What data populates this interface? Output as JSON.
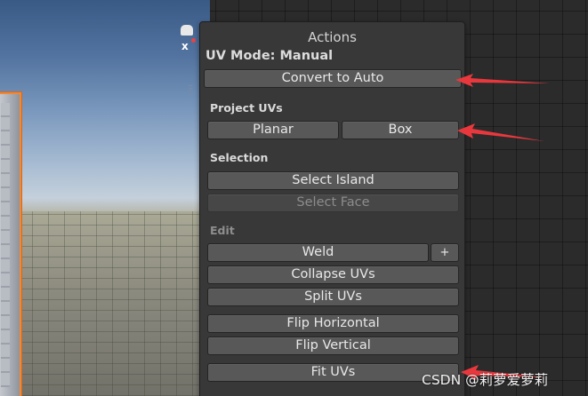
{
  "scene": {
    "gizmo_axis_label": "x"
  },
  "panel": {
    "title": "Actions",
    "mode_label": "UV Mode: Manual",
    "convert_button": "Convert to Auto",
    "sections": {
      "project_uvs": "Project UVs",
      "selection": "Selection",
      "edit": "Edit"
    },
    "buttons": {
      "planar": "Planar",
      "box": "Box",
      "select_island": "Select Island",
      "select_face": "Select Face",
      "weld": "Weld",
      "weld_plus": "+",
      "collapse_uvs": "Collapse UVs",
      "split_uvs": "Split UVs",
      "flip_horizontal": "Flip Horizontal",
      "flip_vertical": "Flip Vertical",
      "fit_uvs": "Fit UVs"
    }
  },
  "annotations": {
    "arrow_color": "#e8383d"
  },
  "watermark": "CSDN @莉萝爱萝莉",
  "colors": {
    "panel_bg": "#383838",
    "button_bg": "#585858",
    "disabled_text": "#8c8c8c"
  }
}
